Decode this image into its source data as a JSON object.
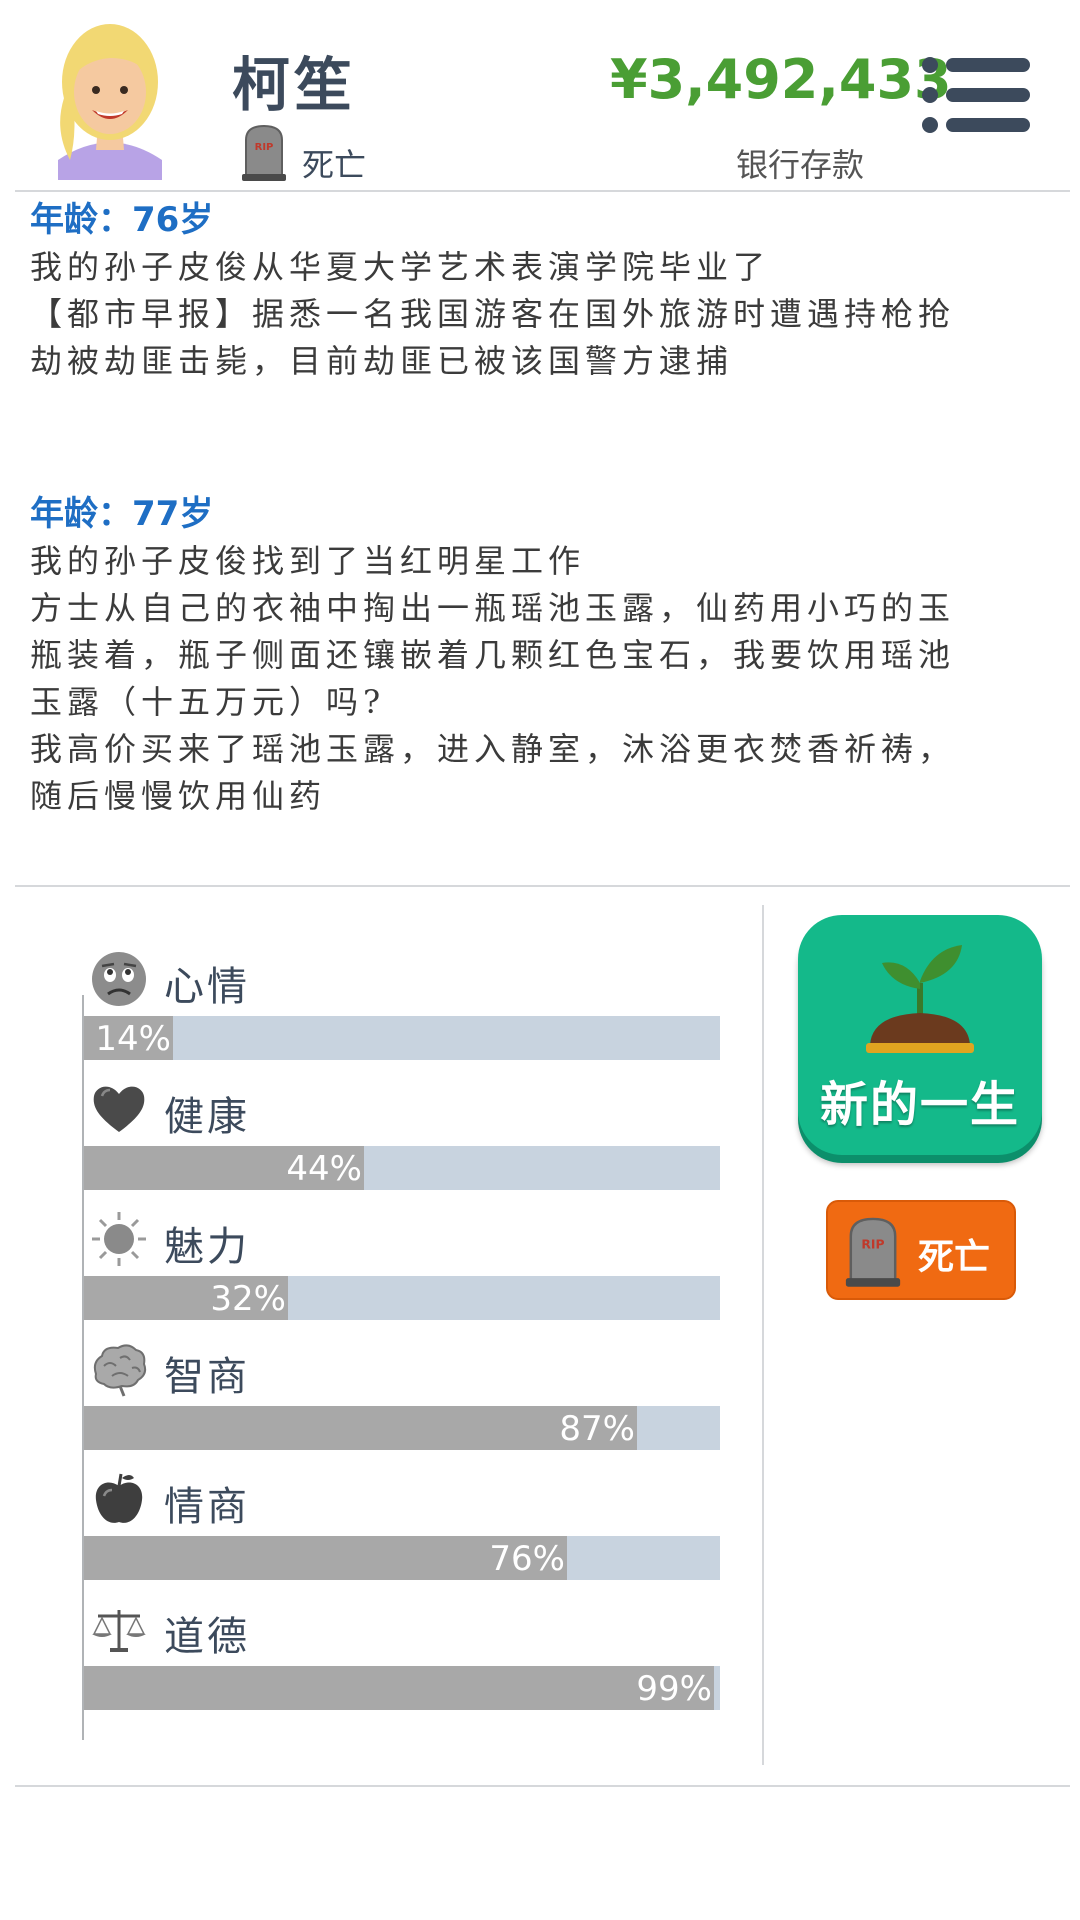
{
  "header": {
    "name": "柯笙",
    "status": "死亡",
    "money": "¥3,492,433",
    "money_label": "银行存款"
  },
  "log": [
    {
      "age": "年龄：76岁",
      "lines": [
        "我的孙子皮俊从华夏大学艺术表演学院毕业了",
        "【都市早报】据悉一名我国游客在国外旅游时遭遇持枪抢",
        "劫被劫匪击毙，目前劫匪已被该国警方逮捕"
      ]
    },
    {
      "age": "年龄：77岁",
      "lines": [
        "我的孙子皮俊找到了当红明星工作",
        "方士从自己的衣袖中掏出一瓶瑶池玉露，仙药用小巧的玉",
        "瓶装着，瓶子侧面还镶嵌着几颗红色宝石，我要饮用瑶池",
        "玉露（十五万元）吗?",
        "我高价买来了瑶池玉露，进入静室，沐浴更衣焚香祈祷，",
        "随后慢慢饮用仙药"
      ]
    }
  ],
  "stats": [
    {
      "label": "心情",
      "value": 14,
      "text": "14%",
      "icon": "sad-face-icon"
    },
    {
      "label": "健康",
      "value": 44,
      "text": "44%",
      "icon": "heart-icon"
    },
    {
      "label": "魅力",
      "value": 32,
      "text": "32%",
      "icon": "sun-icon"
    },
    {
      "label": "智商",
      "value": 87,
      "text": "87%",
      "icon": "brain-icon"
    },
    {
      "label": "情商",
      "value": 76,
      "text": "76%",
      "icon": "apple-icon"
    },
    {
      "label": "道德",
      "value": 99,
      "text": "99%",
      "icon": "scales-icon"
    }
  ],
  "buttons": {
    "new_life": "新的一生",
    "death": "死亡"
  },
  "colors": {
    "money": "#4a9e34",
    "age": "#1e6ec4",
    "bar_track": "#c8d3df",
    "bar_fill": "#a8a8a8",
    "new_life": "#14b98a",
    "death": "#f06a12"
  }
}
